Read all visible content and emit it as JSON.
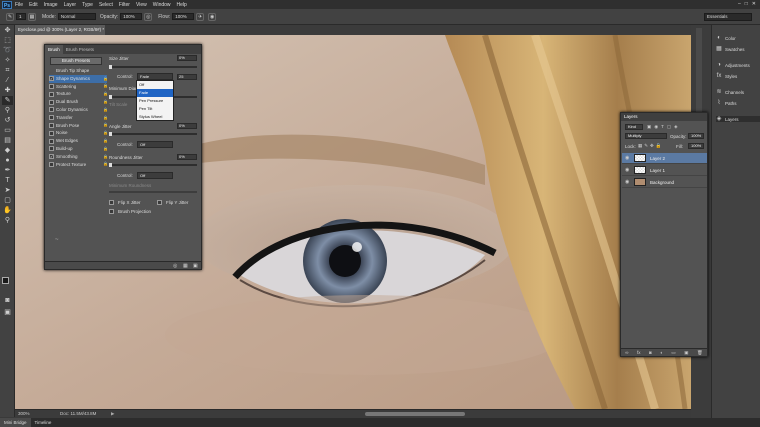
{
  "app": {
    "logo": "Ps"
  },
  "menu": [
    "File",
    "Edit",
    "Image",
    "Layer",
    "Type",
    "Select",
    "Filter",
    "View",
    "Window",
    "Help"
  ],
  "window_controls": {
    "minimize": "–",
    "maximize": "□",
    "close": "✕"
  },
  "options": {
    "brush_size": "1",
    "mode_label": "Mode:",
    "mode_value": "Normal",
    "opacity_label": "Opacity:",
    "opacity_value": "100%",
    "flow_label": "Flow:",
    "flow_value": "100%",
    "workspace": "Essentials"
  },
  "document": {
    "tab_title": "Eyeclose.psd @ 300% (Layer 2, RGB/8#) *"
  },
  "status": {
    "zoom": "300%",
    "doc": "Doc: 11.5M/43.8M"
  },
  "bottom_tabs": [
    "Mini Bridge",
    "Timeline"
  ],
  "brush_panel": {
    "tabs": [
      "Brush",
      "Brush Presets"
    ],
    "presets_button": "Brush Presets",
    "list": [
      {
        "label": "Brush Tip Shape",
        "checked": false,
        "selected": false,
        "checkbox": false
      },
      {
        "label": "Shape Dynamics",
        "checked": true,
        "selected": true,
        "checkbox": true
      },
      {
        "label": "Scattering",
        "checked": false,
        "selected": false,
        "checkbox": true
      },
      {
        "label": "Texture",
        "checked": false,
        "selected": false,
        "checkbox": true
      },
      {
        "label": "Dual Brush",
        "checked": false,
        "selected": false,
        "checkbox": true
      },
      {
        "label": "Color Dynamics",
        "checked": false,
        "selected": false,
        "checkbox": true
      },
      {
        "label": "Transfer",
        "checked": false,
        "selected": false,
        "checkbox": true
      },
      {
        "label": "Brush Pose",
        "checked": false,
        "selected": false,
        "checkbox": true
      },
      {
        "label": "Noise",
        "checked": false,
        "selected": false,
        "checkbox": true
      },
      {
        "label": "Wet Edges",
        "checked": false,
        "selected": false,
        "checkbox": true
      },
      {
        "label": "Build-up",
        "checked": false,
        "selected": false,
        "checkbox": true
      },
      {
        "label": "Smoothing",
        "checked": true,
        "selected": false,
        "checkbox": true
      },
      {
        "label": "Protect Texture",
        "checked": false,
        "selected": false,
        "checkbox": true
      }
    ],
    "size_jitter_label": "Size Jitter",
    "size_jitter_value": "0%",
    "control_label": "Control:",
    "control_value": "Fade",
    "fade_steps": "25",
    "min_diameter_label": "Minimum Diameter",
    "tilt_scale_label": "Tilt Scale",
    "angle_jitter_label": "Angle Jitter",
    "angle_jitter_value": "0%",
    "control2_label": "Control:",
    "control2_value": "Off",
    "roundness_label": "Roundness Jitter",
    "roundness_value": "0%",
    "control3_label": "Control:",
    "control3_value": "Off",
    "min_roundness_label": "Minimum Roundness",
    "flip_x": "Flip X Jitter",
    "flip_y": "Flip Y Jitter",
    "brush_projection": "Brush Projection",
    "dropdown": [
      {
        "label": "Off",
        "selected": false
      },
      {
        "label": "Fade",
        "selected": true
      },
      {
        "label": "Pen Pressure",
        "selected": false
      },
      {
        "label": "Pen Tilt",
        "selected": false
      },
      {
        "label": "Stylus Wheel",
        "selected": false
      }
    ]
  },
  "dock": [
    {
      "label": "Color",
      "icon": "color-icon"
    },
    {
      "label": "Swatches",
      "icon": "swatches-icon"
    },
    {
      "label": "Adjustments",
      "icon": "adjustments-icon"
    },
    {
      "label": "Styles",
      "icon": "styles-icon"
    },
    {
      "label": "Channels",
      "icon": "channels-icon"
    },
    {
      "label": "Paths",
      "icon": "paths-icon"
    },
    {
      "label": "Layers",
      "icon": "layers-icon"
    }
  ],
  "layers_panel": {
    "title": "Layers",
    "kind": "Kind",
    "blend_mode": "Multiply",
    "opacity_label": "Opacity:",
    "opacity_value": "100%",
    "lock_label": "Lock:",
    "fill_label": "Fill:",
    "fill_value": "100%",
    "layers": [
      {
        "name": "Layer 2",
        "selected": true,
        "type": "transparent"
      },
      {
        "name": "Layer 1",
        "selected": false,
        "type": "transparent"
      },
      {
        "name": "Background",
        "selected": false,
        "type": "photo"
      }
    ]
  }
}
